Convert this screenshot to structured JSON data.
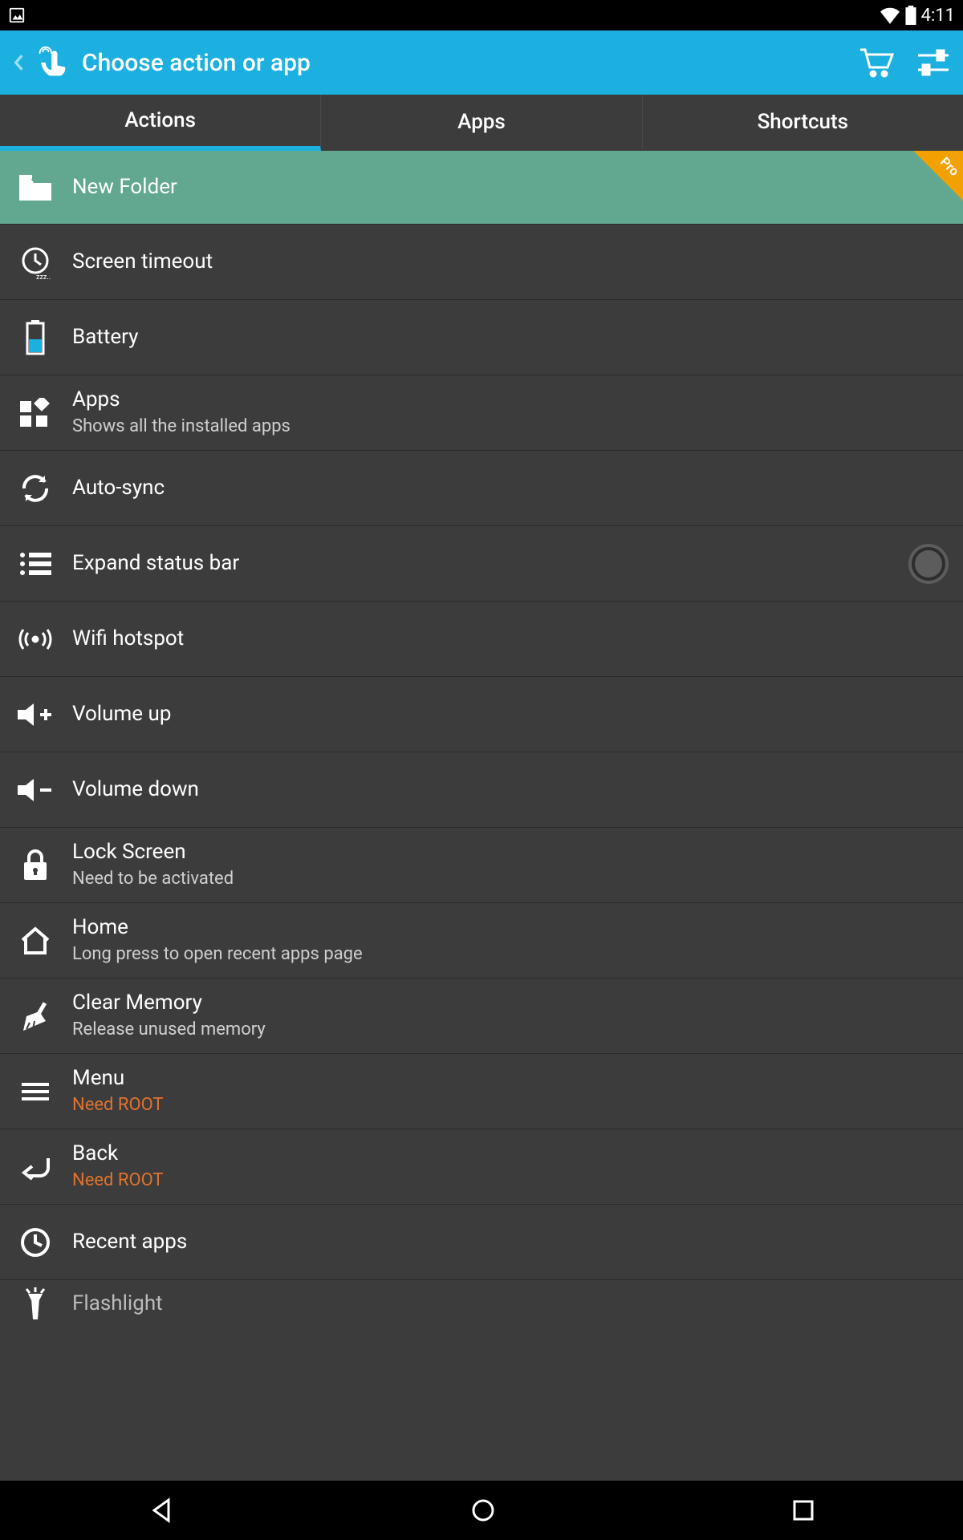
{
  "status": {
    "time": "4:11"
  },
  "header": {
    "title": "Choose action or app"
  },
  "tabs": {
    "t0": "Actions",
    "t1": "Apps",
    "t2": "Shortcuts"
  },
  "pro_label": "Pro",
  "items": {
    "new_folder": {
      "title": "New Folder"
    },
    "screen_timeout": {
      "title": "Screen timeout"
    },
    "battery": {
      "title": "Battery"
    },
    "apps": {
      "title": "Apps",
      "sub": "Shows all the installed apps"
    },
    "auto_sync": {
      "title": "Auto-sync"
    },
    "expand_status_bar": {
      "title": "Expand status bar"
    },
    "wifi_hotspot": {
      "title": "Wifi hotspot"
    },
    "volume_up": {
      "title": "Volume up"
    },
    "volume_down": {
      "title": "Volume down"
    },
    "lock_screen": {
      "title": "Lock Screen",
      "sub": "Need to be activated"
    },
    "home": {
      "title": "Home",
      "sub": "Long press to open recent apps page"
    },
    "clear_memory": {
      "title": "Clear Memory",
      "sub": "Release unused memory"
    },
    "menu": {
      "title": "Menu",
      "sub": "Need ROOT"
    },
    "back": {
      "title": "Back",
      "sub": "Need ROOT"
    },
    "recent_apps": {
      "title": "Recent apps"
    },
    "flashlight": {
      "title": "Flashlight"
    }
  }
}
